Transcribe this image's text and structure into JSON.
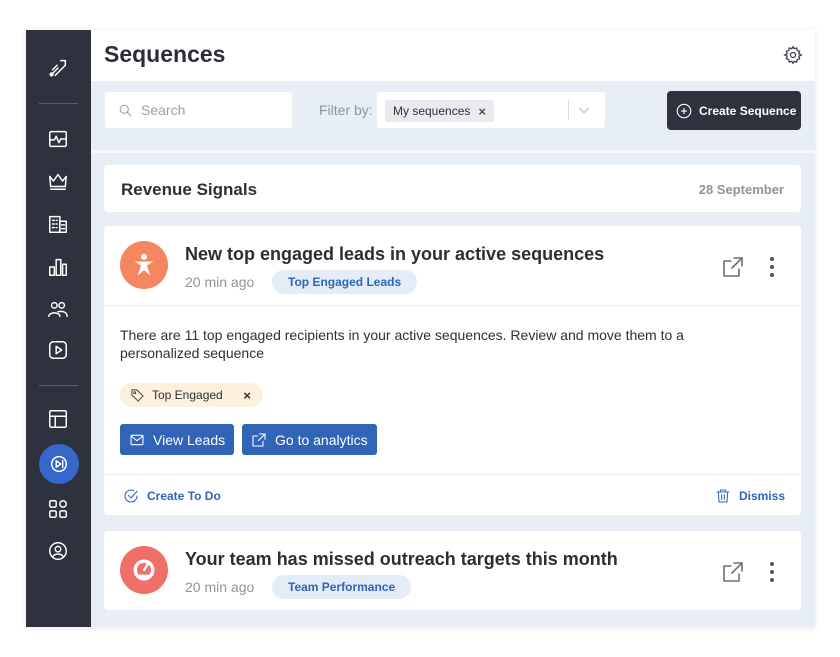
{
  "header": {
    "title": "Sequences"
  },
  "toolbar": {
    "search_placeholder": "Search",
    "filter_label": "Filter by:",
    "filter_chip": "My sequences",
    "create_button": "Create Sequence"
  },
  "signals": {
    "title": "Revenue Signals",
    "date": "28 September"
  },
  "cards": [
    {
      "title": "New top engaged leads in your active sequences",
      "time": "20 min ago",
      "badge": "Top Engaged Leads",
      "description": "There are 11 top engaged recipients in your active sequences. Review and move them to a personalized sequence",
      "tag": "Top Engaged",
      "buttons": [
        "View Leads",
        "Go to analytics"
      ],
      "footer_left": "Create To Do",
      "footer_right": "Dismiss",
      "avatar_color": "#f58660"
    },
    {
      "title": "Your team has missed outreach targets this month",
      "time": "20 min ago",
      "badge": "Team Performance",
      "avatar_color": "#f07068"
    }
  ],
  "sidebar": {
    "icons": [
      "logo-icon",
      "activity-icon",
      "crown-icon",
      "building-icon",
      "bar-chart-icon",
      "users-icon",
      "play-icon",
      "layout-icon",
      "sequences-icon",
      "apps-icon",
      "profile-icon"
    ]
  },
  "colors": {
    "sidebar": "#2e323e",
    "accent": "#2f64b8",
    "active": "#3467c7",
    "background": "#e8eef6"
  }
}
